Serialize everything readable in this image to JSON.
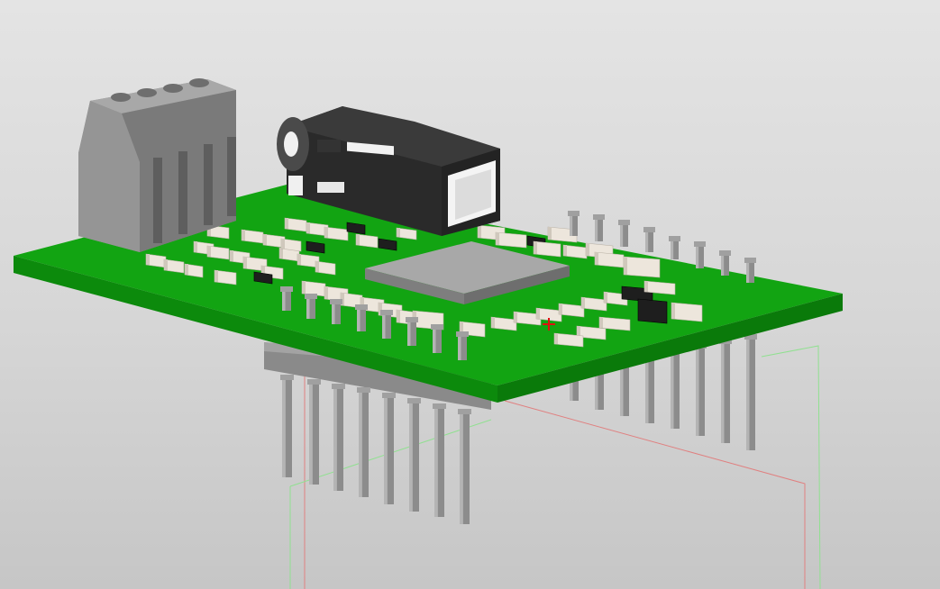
{
  "viewport": {
    "background_top": "#e4e4e4",
    "background_bottom": "#c6c6c6"
  },
  "board": {
    "color_top": "#12a412",
    "color_edge_front": "#0c8a0c",
    "color_edge_right": "#0a7a0a"
  },
  "colors": {
    "smd_body": "#ede6dc",
    "smd_end": "#d0c8bc",
    "ic_black": "#1e1e1e",
    "pin": "#8c8c8c",
    "chip": "#9e9e9e",
    "terminal_block": "#808080",
    "audio_jack": "#2a2a2a",
    "origin_marker": "#e01010",
    "wire_red": "#e08080",
    "wire_green": "#90e090"
  },
  "icons": {
    "origin": "coordinate-origin-icon"
  }
}
